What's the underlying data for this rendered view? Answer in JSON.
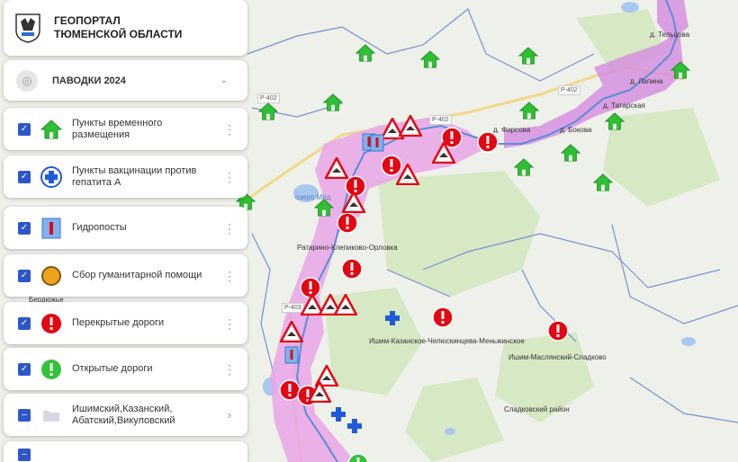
{
  "header": {
    "title_line1": "ГЕОПОРТАЛ",
    "title_line2": "ТЮМЕНСКОЙ ОБЛАСТИ"
  },
  "layer_select": {
    "label": "ПАВОДКИ 2024"
  },
  "legend_items": [
    {
      "label": "Пункты временного размещения",
      "icon": "green-house-icon"
    },
    {
      "label": "Пункты вакцинации против гепатита А",
      "icon": "blue-cross-icon"
    },
    {
      "label": "Гидропосты",
      "icon": "hydropost-icon"
    },
    {
      "label": "Сбор гуманитарной помощи",
      "icon": "orange-circle-icon"
    },
    {
      "label": "Перекрытые дороги",
      "icon": "red-exclamation-icon"
    },
    {
      "label": "Открытые дороги",
      "icon": "green-exclamation-icon"
    },
    {
      "label": "Ишимский,Казанский, Абатский,Викуловский",
      "icon": "folder-icon"
    }
  ],
  "map_labels": {
    "village1": "д. Тельцова",
    "village2": "д. Лапина",
    "village3": "д. Татарская",
    "village4": "д. Фирсова",
    "village5": "д. Бокова",
    "village6": "Ратарино-Клепиково-Орловка",
    "village7": "Ишим-Казанское-Челюскинцева-Меньжинское",
    "village8": "Ишим-Маслянский-Сладково",
    "district": "Сладковский район",
    "lake": "озеро Мёд",
    "village9": "Бердюжье"
  },
  "roads": {
    "r1": "Р-402",
    "r2": "Р-402",
    "r3": "Р-402",
    "r4": "Р-403"
  },
  "colors": {
    "closed": "#e30613",
    "open": "#33c33b",
    "shelter": "#2fbf33",
    "cross": "#1f5bd8",
    "flood": "#e9a4e8",
    "border": "#7b8fd0",
    "river": "#5a8cd8",
    "checkbox": "#2d57c8"
  }
}
